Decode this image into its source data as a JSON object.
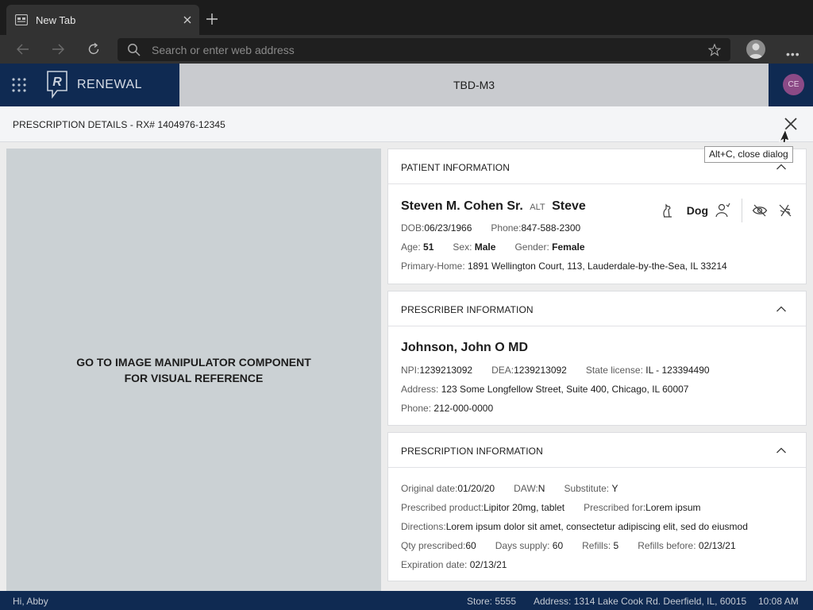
{
  "browser": {
    "tab_title": "New Tab",
    "omnibox_placeholder": "Search or enter web address"
  },
  "app": {
    "brand": "RENEWAL",
    "title": "TBD-M3",
    "user_initials": "CE",
    "colors": {
      "header": "#0f2a52",
      "avatar": "#8b4a86"
    }
  },
  "dialog": {
    "title": "PRESCRIPTION DETAILS - RX# 1404976-12345",
    "close_tooltip": "Alt+C, close dialog",
    "image_placeholder_line1": "GO TO IMAGE MANIPULATOR COMPONENT",
    "image_placeholder_line2": "FOR VISUAL REFERENCE"
  },
  "patient": {
    "section_title": "PATIENT INFORMATION",
    "name": "Steven M. Cohen Sr.",
    "alt_label": "ALT",
    "alt_name": "Steve",
    "species": "Dog",
    "dob_label": "DOB:",
    "dob": "06/23/1966",
    "phone_label": "Phone:",
    "phone": "847-588-2300",
    "age_label": "Age:",
    "age": "51",
    "sex_label": "Sex:",
    "sex": "Male",
    "gender_label": "Gender:",
    "gender": "Female",
    "address_label": "Primary-Home:",
    "address": "1891 Wellington Court, 113, Lauderdale-by-the-Sea, IL 33214"
  },
  "prescriber": {
    "section_title": "PRESCRIBER INFORMATION",
    "name": "Johnson, John O MD",
    "npi_label": "NPI:",
    "npi": "1239213092",
    "dea_label": "DEA:",
    "dea": "1239213092",
    "license_label": "State license:",
    "license": "IL - 123394490",
    "address_label": "Address:",
    "address": "123 Some Longfellow Street, Suite 400, Chicago, IL 60007",
    "phone_label": "Phone:",
    "phone": "212-000-0000"
  },
  "prescription": {
    "section_title": "PRESCRIPTION INFORMATION",
    "original_date_label": "Original date:",
    "original_date": "01/20/20",
    "daw_label": "DAW:",
    "daw": "N",
    "substitute_label": "Substitute:",
    "substitute": "Y",
    "product_label": "Prescribed product:",
    "product": "Lipitor 20mg, tablet",
    "for_label": "Prescribed for:",
    "for": "Lorem ipsum",
    "directions_label": "Directions:",
    "directions": "Lorem ipsum dolor sit amet, consectetur adipiscing elit, sed do eiusmod",
    "qty_label": "Qty prescribed:",
    "qty": "60",
    "days_label": "Days supply:",
    "days": "60",
    "refills_label": "Refills:",
    "refills": "5",
    "refills_before_label": "Refills before:",
    "refills_before": "02/13/21",
    "expiration_label": "Expiration date:",
    "expiration": "02/13/21"
  },
  "status": {
    "greeting": "Hi, Abby",
    "store": "Store: 5555",
    "address": "Address: 1314 Lake Cook Rd. Deerfield, IL, 60015",
    "time": "10:08 AM"
  }
}
